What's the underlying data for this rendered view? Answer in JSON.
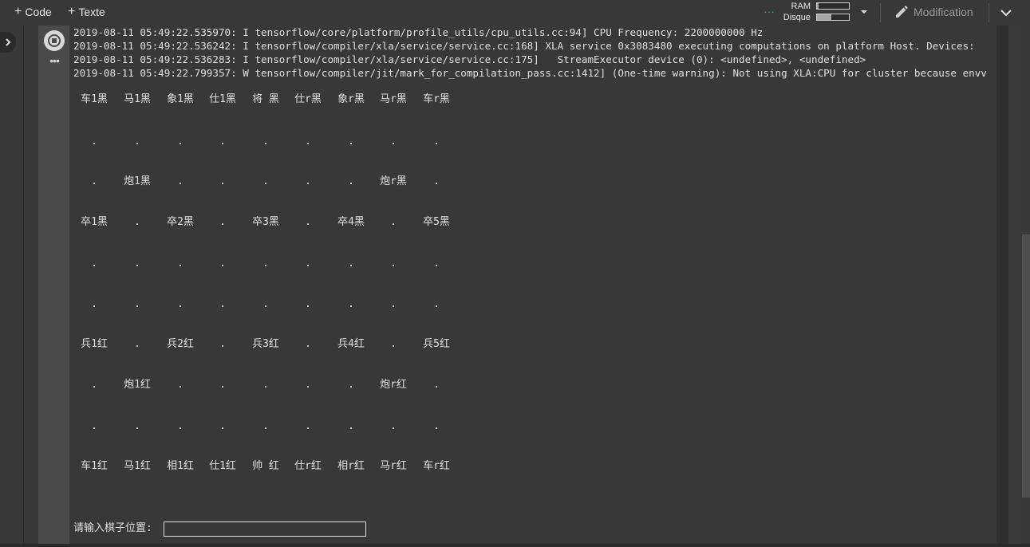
{
  "toolbar": {
    "code_label": "Code",
    "text_label": "Texte",
    "ram_label": "RAM",
    "disk_label": "Disque",
    "ram_usage": 0.05,
    "disk_usage": 0.45,
    "edit_label": "Modification",
    "status_color": "#1ec35a"
  },
  "log_lines": [
    "2019-08-11 05:49:22.535970: I tensorflow/core/platform/profile_utils/cpu_utils.cc:94] CPU Frequency: 2200000000 Hz",
    "2019-08-11 05:49:22.536242: I tensorflow/compiler/xla/service/service.cc:168] XLA service 0x3083480 executing computations on platform Host. Devices:",
    "2019-08-11 05:49:22.536283: I tensorflow/compiler/xla/service/service.cc:175]   StreamExecutor device (0): <undefined>, <undefined>",
    "2019-08-11 05:49:22.799357: W tensorflow/compiler/jit/mark_for_compilation_pass.cc:1412] (One-time warning): Not using XLA:CPU for cluster because envv"
  ],
  "board": [
    [
      "车1黑",
      "马1黑",
      "象1黑",
      "仕1黑",
      "将 黑",
      "仕r黑",
      "象r黑",
      "马r黑",
      "车r黑"
    ],
    [
      ".",
      ".",
      ".",
      ".",
      ".",
      ".",
      ".",
      ".",
      "."
    ],
    [
      ".",
      "炮1黑",
      ".",
      ".",
      ".",
      ".",
      ".",
      "炮r黑",
      "."
    ],
    [
      "卒1黑",
      ".",
      "卒2黑",
      ".",
      "卒3黑",
      ".",
      "卒4黑",
      ".",
      "卒5黑"
    ],
    [
      ".",
      ".",
      ".",
      ".",
      ".",
      ".",
      ".",
      ".",
      "."
    ],
    [
      ".",
      ".",
      ".",
      ".",
      ".",
      ".",
      ".",
      ".",
      "."
    ],
    [
      "兵1红",
      ".",
      "兵2红",
      ".",
      "兵3红",
      ".",
      "兵4红",
      ".",
      "兵5红"
    ],
    [
      ".",
      "炮1红",
      ".",
      ".",
      ".",
      ".",
      ".",
      "炮r红",
      "."
    ],
    [
      ".",
      ".",
      ".",
      ".",
      ".",
      ".",
      ".",
      ".",
      "."
    ],
    [
      "车1红",
      "马1红",
      "相1红",
      "仕1红",
      "帅 红",
      "仕r红",
      "相r红",
      "马r红",
      "车r红"
    ]
  ],
  "prompt": {
    "label": "请输入棋子位置:",
    "value": ""
  }
}
